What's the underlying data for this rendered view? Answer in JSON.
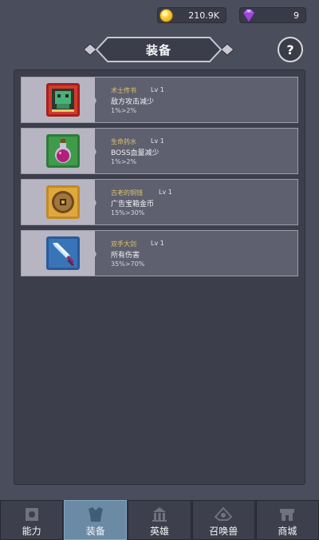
{
  "currency": {
    "gold": "210.9K",
    "gems": "9"
  },
  "title": "装备",
  "help_label": "?",
  "equipment": [
    {
      "name": "术士传书",
      "level": "Lv 1",
      "effect": "敌方攻击减少",
      "value": "1%>2%",
      "icon": "red-book-icon"
    },
    {
      "name": "生命药水",
      "level": "Lv 1",
      "effect": "BOSS血量减少",
      "value": "1%>2%",
      "icon": "potion-icon"
    },
    {
      "name": "古老的铜钱",
      "level": "Lv 1",
      "effect": "广告宝箱金币",
      "value": "15%>30%",
      "icon": "coin-icon"
    },
    {
      "name": "双手大剑",
      "level": "Lv 1",
      "effect": "所有伤害",
      "value": "35%>70%",
      "icon": "sword-icon"
    }
  ],
  "nav": [
    {
      "label": "能力",
      "icon": "ability-icon",
      "active": false
    },
    {
      "label": "装备",
      "icon": "armor-icon",
      "active": true
    },
    {
      "label": "英雄",
      "icon": "hero-icon",
      "active": false
    },
    {
      "label": "召唤兽",
      "icon": "summon-icon",
      "active": false
    },
    {
      "label": "商城",
      "icon": "shop-icon",
      "active": false
    }
  ],
  "colors": {
    "background": "#4a4d5c",
    "card_left": "#b7b5c2",
    "card_right": "#5e6070",
    "item_name": "#e0c36a",
    "nav_active": "#6a8aa6"
  }
}
